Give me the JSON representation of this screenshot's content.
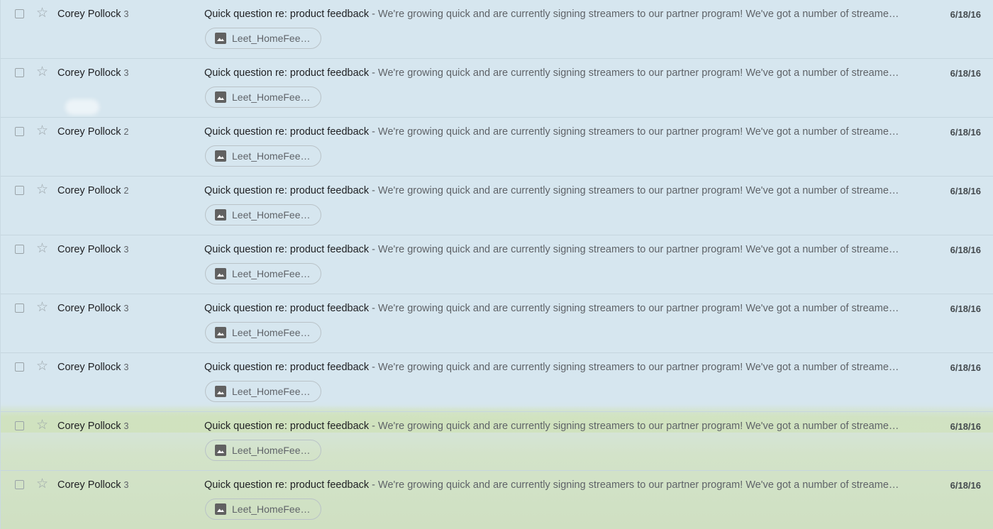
{
  "emails": [
    {
      "sender": "Corey Pollock",
      "count": "3",
      "subject": "Quick question re: product feedback",
      "snippet": "We're growing quick and are currently signing streamers to our partner program! We've got a number of streame…",
      "date": "6/18/16",
      "attachment": "Leet_HomeFee…",
      "separator": " - "
    },
    {
      "sender": "Corey Pollock",
      "count": "3",
      "subject": "Quick question re: product feedback",
      "snippet": "We're growing quick and are currently signing streamers to our partner program! We've got a number of streame…",
      "date": "6/18/16",
      "attachment": "Leet_HomeFee…",
      "separator": " - "
    },
    {
      "sender": "Corey Pollock",
      "count": "2",
      "subject": "Quick question re: product feedback",
      "snippet": "We're growing quick and are currently signing streamers to our partner program! We've got a number of streame…",
      "date": "6/18/16",
      "attachment": "Leet_HomeFee…",
      "separator": " - "
    },
    {
      "sender": "Corey Pollock",
      "count": "2",
      "subject": "Quick question re: product feedback",
      "snippet": "We're growing quick and are currently signing streamers to our partner program! We've got a number of streame…",
      "date": "6/18/16",
      "attachment": "Leet_HomeFee…",
      "separator": " - "
    },
    {
      "sender": "Corey Pollock",
      "count": "3",
      "subject": "Quick question re: product feedback",
      "snippet": "We're growing quick and are currently signing streamers to our partner program! We've got a number of streame…",
      "date": "6/18/16",
      "attachment": "Leet_HomeFee…",
      "separator": " - "
    },
    {
      "sender": "Corey Pollock",
      "count": "3",
      "subject": "Quick question re: product feedback",
      "snippet": "We're growing quick and are currently signing streamers to our partner program! We've got a number of streame…",
      "date": "6/18/16",
      "attachment": "Leet_HomeFee…",
      "separator": " - "
    },
    {
      "sender": "Corey Pollock",
      "count": "3",
      "subject": "Quick question re: product feedback",
      "snippet": "We're growing quick and are currently signing streamers to our partner program! We've got a number of streame…",
      "date": "6/18/16",
      "attachment": "Leet_HomeFee…",
      "separator": " - "
    },
    {
      "sender": "Corey Pollock",
      "count": "3",
      "subject": "Quick question re: product feedback",
      "snippet": "We're growing quick and are currently signing streamers to our partner program! We've got a number of streame…",
      "date": "6/18/16",
      "attachment": "Leet_HomeFee…",
      "separator": " - "
    },
    {
      "sender": "Corey Pollock",
      "count": "3",
      "subject": "Quick question re: product feedback",
      "snippet": "We're growing quick and are currently signing streamers to our partner program! We've got a number of streame…",
      "date": "6/18/16",
      "attachment": "Leet_HomeFee…",
      "separator": " - "
    }
  ],
  "icons": {
    "checkbox": "checkbox-icon",
    "star": "star-outline-icon",
    "attachment": "image-icon"
  },
  "colors": {
    "background_sky": "#d6e6ef",
    "background_grass": "#cfe0c2",
    "text_primary": "#202124",
    "text_secondary": "#5f6368"
  }
}
